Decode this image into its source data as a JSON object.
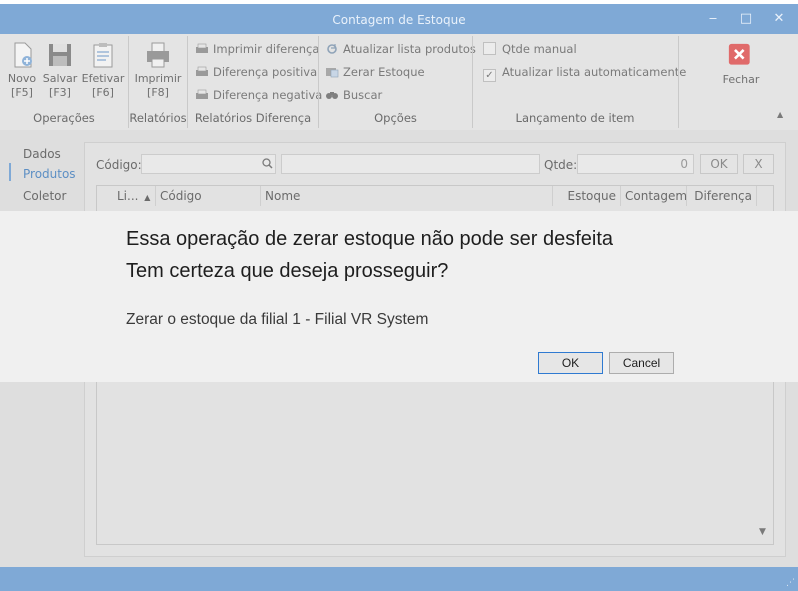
{
  "window": {
    "title": "Contagem de Estoque",
    "minimize_icon": "minimize-icon",
    "maximize_icon": "maximize-icon",
    "close_icon": "close-icon",
    "glyphs": {
      "minimize": "‒",
      "maximize": "□",
      "close": "✕"
    }
  },
  "ribbon": {
    "operacoes": {
      "label": "Operações",
      "novo": {
        "label": "Novo",
        "shortcut": "[F5]"
      },
      "salvar": {
        "label": "Salvar",
        "shortcut": "[F3]"
      },
      "efetivar": {
        "label": "Efetivar",
        "shortcut": "[F6]"
      }
    },
    "relatorios": {
      "label": "Relatórios",
      "imprimir": {
        "label": "Imprimir",
        "shortcut": "[F8]"
      }
    },
    "relatorios_diferenca": {
      "label": "Relatórios Diferença",
      "items": [
        "Imprimir diferença",
        "Diferença positiva",
        "Diferença negativa"
      ]
    },
    "opcoes": {
      "label": "Opções",
      "items": [
        "Atualizar lista produtos",
        "Zerar Estoque",
        "Buscar"
      ]
    },
    "lancamento": {
      "label": "Lançamento de item",
      "qtde_manual": {
        "label": "Qtde manual",
        "checked": false
      },
      "atualizar_lista": {
        "label": "Atualizar lista automaticamente",
        "checked": true
      }
    },
    "fechar": {
      "label": "Fechar"
    },
    "collapse_glyph": "▲"
  },
  "nav": {
    "items": [
      "Dados",
      "Produtos",
      "Coletor"
    ],
    "active": "Produtos"
  },
  "entry": {
    "codigo_label": "Código:",
    "qtde_label": "Qtde:",
    "qtde_value": "0",
    "ok_label": "OK",
    "clear_label": "X"
  },
  "grid": {
    "columns": [
      "Li...",
      "Código",
      "Nome",
      "Estoque",
      "Contagem",
      "Diferença"
    ],
    "sort_glyph": "▲",
    "scroll_glyph": "▼"
  },
  "dialog": {
    "message_line1": "Essa operação de zerar estoque não pode ser desfeita",
    "message_line2": "Tem certeza que deseja prosseguir?",
    "detail": "Zerar o estoque da filial 1 - Filial VR System",
    "ok_label": "OK",
    "cancel_label": "Cancel"
  },
  "colors": {
    "accent": "#7fa9d6",
    "ribbon_bg": "#e4e4e4",
    "dialog_bg": "#f0f0f0",
    "close_red": "#e06a6a"
  }
}
